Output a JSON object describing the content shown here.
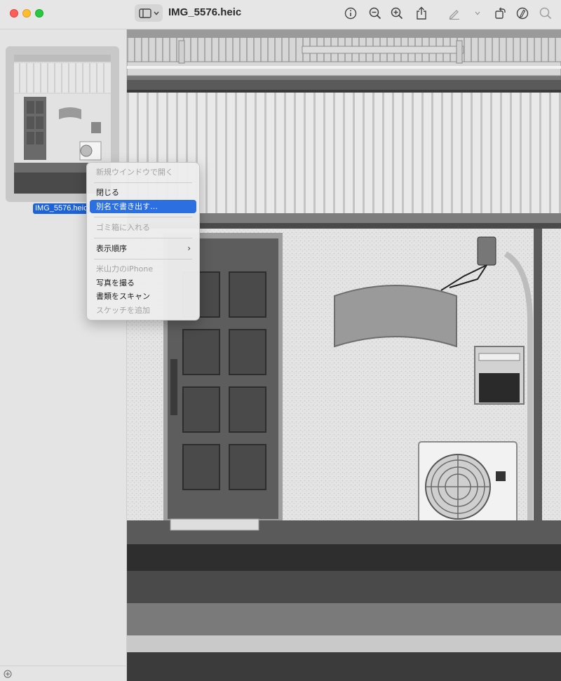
{
  "window": {
    "title": "IMG_5576.heic"
  },
  "toolbar": {
    "icons": [
      "sidebar-toggle-icon",
      "info-icon",
      "zoom-out-icon",
      "zoom-in-icon",
      "share-icon",
      "markup-pen-icon",
      "rotate-icon",
      "markup-circle-icon",
      "search-icon"
    ]
  },
  "sidebar": {
    "thumbnail_label": "IMG_5576.heic"
  },
  "context_menu": {
    "items": [
      {
        "label": "新規ウインドウで開く",
        "enabled": false
      },
      {
        "label": "閉じる",
        "enabled": true
      },
      {
        "label": "別名で書き出す…",
        "enabled": true,
        "highlighted": true
      },
      {
        "label": "ゴミ箱に入れる",
        "enabled": false
      },
      {
        "label": "表示順序",
        "enabled": true,
        "submenu": true
      },
      {
        "label": "米山力のiPhone",
        "enabled": false
      },
      {
        "label": "写真を撮る",
        "enabled": true
      },
      {
        "label": "書類をスキャン",
        "enabled": true
      },
      {
        "label": "スケッチを追加",
        "enabled": false
      }
    ]
  },
  "colors": {
    "highlight": "#2b6fe1",
    "label_selection": "#1d63d6"
  }
}
